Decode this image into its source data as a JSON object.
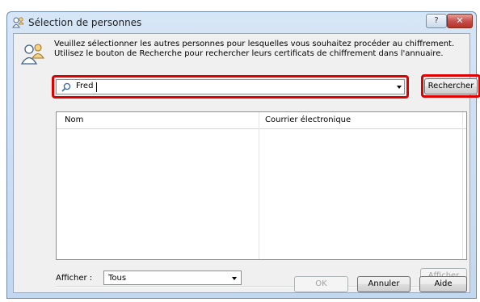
{
  "window": {
    "title": "Sélection de personnes",
    "help_button": "?",
    "close_button": "✕"
  },
  "instructions": "Veuillez sélectionner les autres personnes pour lesquelles vous souhaitez procéder au chiffrement. Utilisez le bouton de Recherche pour rechercher leurs certificats de chiffrement dans l'annuaire.",
  "search": {
    "value": "Fred",
    "button": "Rechercher"
  },
  "list": {
    "columns": [
      "Nom",
      "Courrier électronique"
    ]
  },
  "filter": {
    "label": "Afficher :",
    "selected": "Tous",
    "button": "Afficher"
  },
  "buttons": {
    "ok": "OK",
    "cancel": "Annuler",
    "help": "Aide"
  },
  "colors": {
    "highlight": "#e00000",
    "title_bar": "#c3d7ef"
  }
}
